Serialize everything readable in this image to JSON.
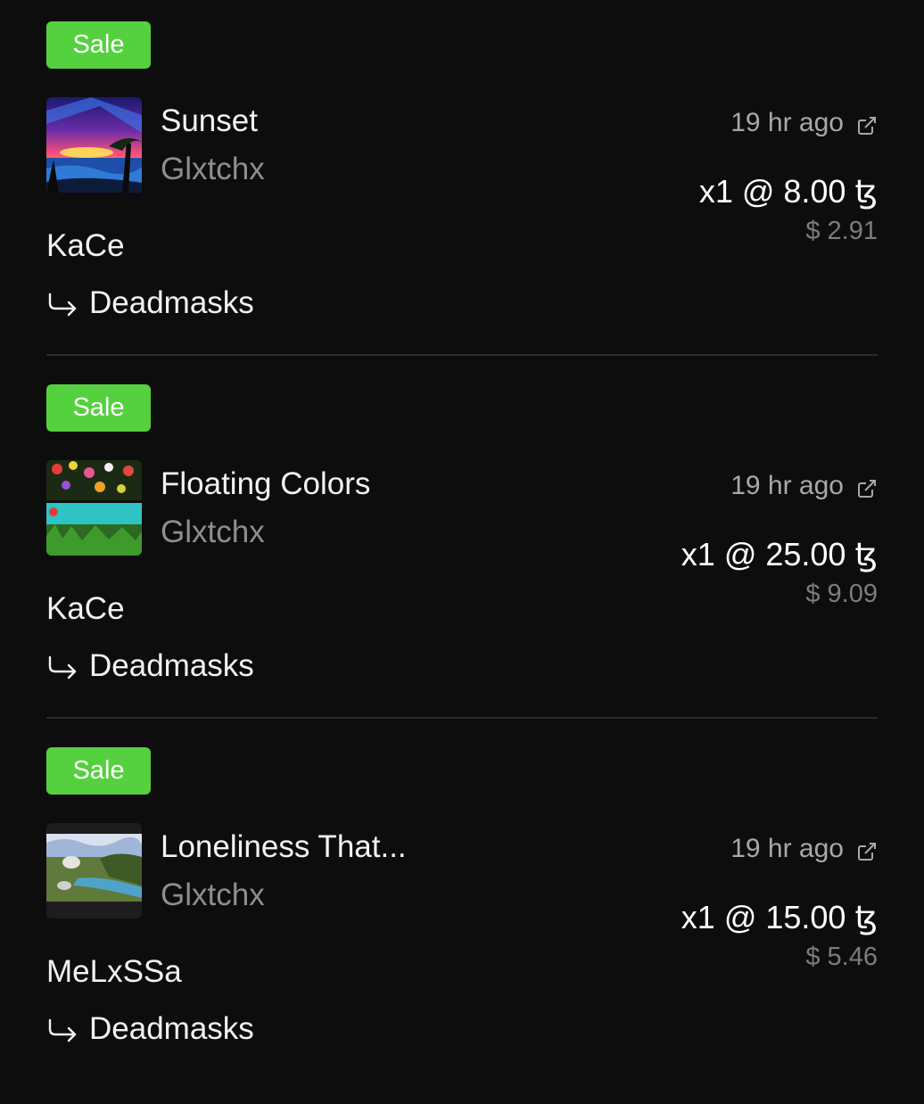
{
  "colors": {
    "background": "#0d0d0d",
    "sale_badge": "#55d13f",
    "muted_text": "#8e8e8e"
  },
  "icons": {
    "external_link": "external-link-icon",
    "collection_arrow": "return-arrow-icon"
  },
  "sales": [
    {
      "badge": "Sale",
      "thumbnail": "sunset-artwork-thumbnail",
      "title": "Sunset",
      "artist": "Glxtchx",
      "time": "19 hr ago",
      "price": "x1 @ 8.00 ꜩ",
      "usd": "$ 2.91",
      "buyer": "KaCe",
      "collection": "Deadmasks"
    },
    {
      "badge": "Sale",
      "thumbnail": "floating-colors-artwork-thumbnail",
      "title": "Floating Colors",
      "artist": "Glxtchx",
      "time": "19 hr ago",
      "price": "x1 @ 25.00 ꜩ",
      "usd": "$ 9.09",
      "buyer": "KaCe",
      "collection": "Deadmasks"
    },
    {
      "badge": "Sale",
      "thumbnail": "loneliness-artwork-thumbnail",
      "title": "Loneliness That...",
      "artist": "Glxtchx",
      "time": "19 hr ago",
      "price": "x1 @ 15.00 ꜩ",
      "usd": "$ 5.46",
      "buyer": "MeLxSSa",
      "collection": "Deadmasks"
    }
  ]
}
